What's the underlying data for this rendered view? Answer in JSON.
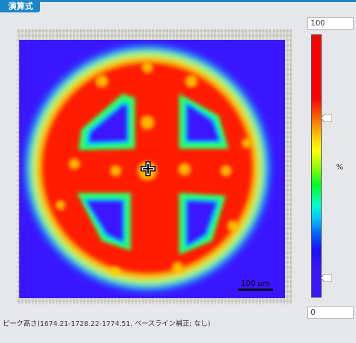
{
  "tab": {
    "label": "演算式"
  },
  "colorbar": {
    "max_value": "100",
    "min_value": "0",
    "unit": "%",
    "upper_handle_fraction": 0.69,
    "lower_handle_fraction": 0.08,
    "colors": [
      "#ff0000",
      "#ffc000",
      "#ffff00",
      "#00ff20",
      "#00c8ff",
      "#1a10ff",
      "#3a16ff"
    ]
  },
  "image": {
    "scale_label": "100 μm",
    "background_color": "#3a16ff",
    "icon": "crosshair-cursor-icon"
  },
  "footer": {
    "text": "ピーク高さ(1674.21-1728.22-1774.51, ベースライン補正: なし)"
  },
  "accent_color": "#1b86c8"
}
